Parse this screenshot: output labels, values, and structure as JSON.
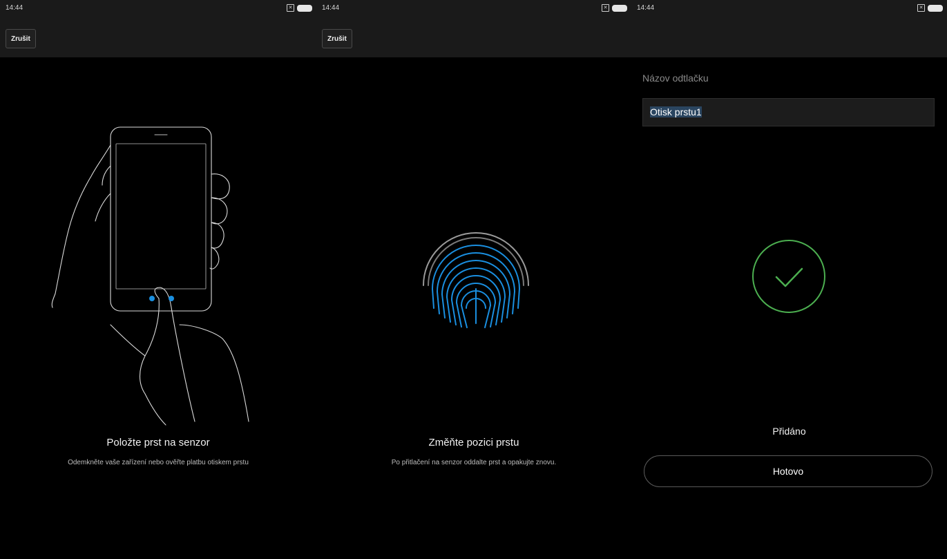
{
  "screens": [
    {
      "status": {
        "time": "14:44",
        "sim_glyph": "✕"
      },
      "cancel_label": "Zrušit",
      "title": "Položte prst na senzor",
      "subtitle": "Odemkněte vaše zařízení nebo ověřte platbu otiskem prstu"
    },
    {
      "status": {
        "time": "14:44",
        "sim_glyph": "✕"
      },
      "cancel_label": "Zrušit",
      "title": "Změňte pozici prstu",
      "subtitle": "Po přitlačení na senzor oddalte prst a opakujte znovu."
    },
    {
      "status": {
        "time": "14:44",
        "sim_glyph": "✕"
      },
      "name_label": "Názov odtlačku",
      "name_value": "Otisk prstu1",
      "result": "Přidáno",
      "done_label": "Hotovo"
    }
  ],
  "colors": {
    "accent_blue": "#1a8fe0",
    "success_green": "#4caf50",
    "topbar": "#1a1a1a"
  }
}
